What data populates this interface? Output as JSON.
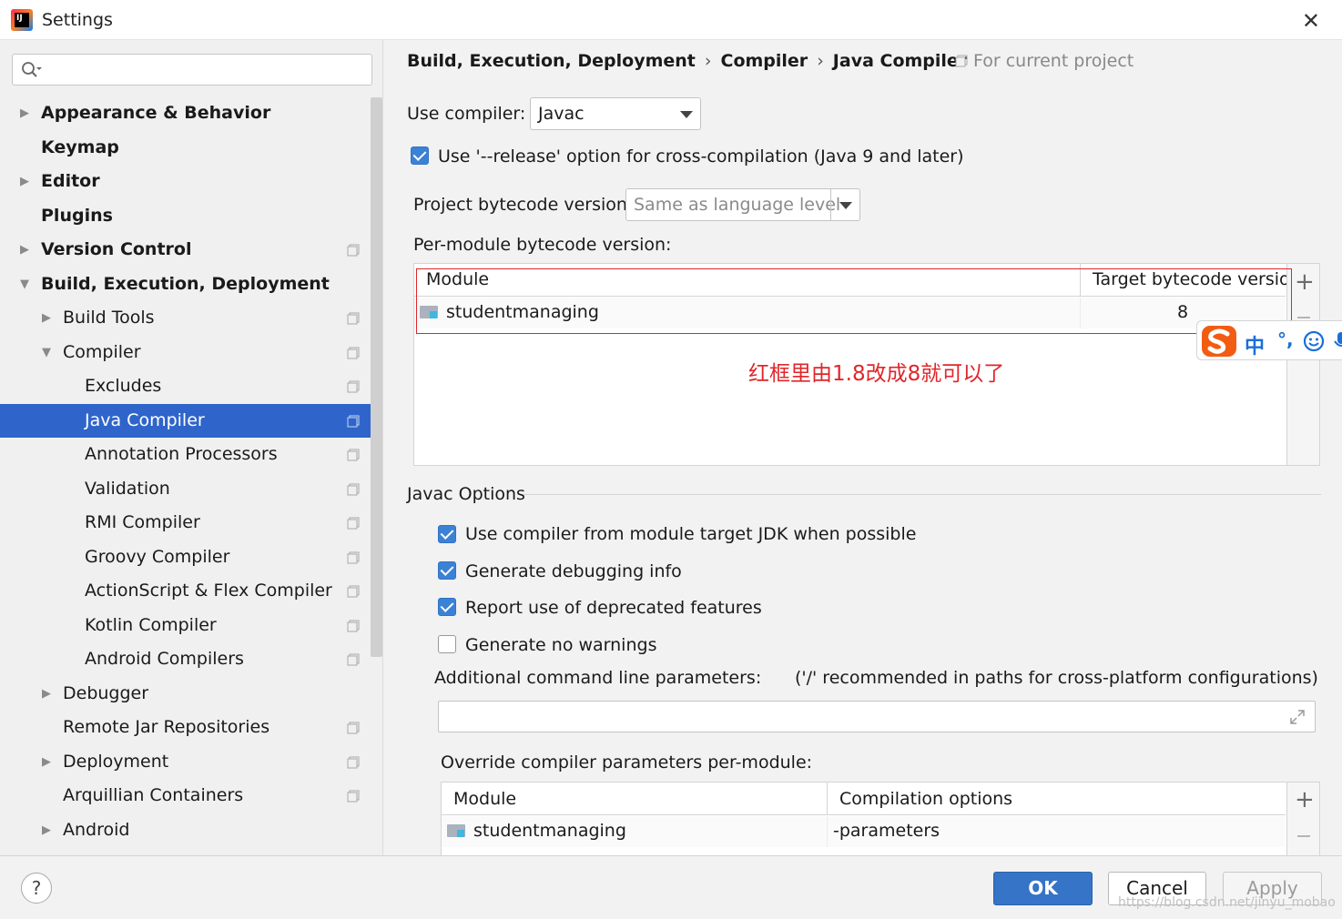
{
  "window": {
    "title": "Settings"
  },
  "search": {
    "placeholder": ""
  },
  "sidebar": {
    "items": [
      {
        "label": "Appearance & Behavior",
        "level": 0,
        "arrow": "right",
        "bold": true,
        "project": false
      },
      {
        "label": "Keymap",
        "level": 0,
        "arrow": "none",
        "bold": true,
        "project": false
      },
      {
        "label": "Editor",
        "level": 0,
        "arrow": "right",
        "bold": true,
        "project": false
      },
      {
        "label": "Plugins",
        "level": 0,
        "arrow": "none",
        "bold": true,
        "project": false
      },
      {
        "label": "Version Control",
        "level": 0,
        "arrow": "right",
        "bold": true,
        "project": true
      },
      {
        "label": "Build, Execution, Deployment",
        "level": 0,
        "arrow": "down",
        "bold": true,
        "project": false
      },
      {
        "label": "Build Tools",
        "level": 1,
        "arrow": "right",
        "bold": false,
        "project": true
      },
      {
        "label": "Compiler",
        "level": 1,
        "arrow": "down",
        "bold": false,
        "project": true
      },
      {
        "label": "Excludes",
        "level": 2,
        "arrow": "none",
        "bold": false,
        "project": true
      },
      {
        "label": "Java Compiler",
        "level": 2,
        "arrow": "none",
        "bold": false,
        "project": true,
        "selected": true
      },
      {
        "label": "Annotation Processors",
        "level": 2,
        "arrow": "none",
        "bold": false,
        "project": true
      },
      {
        "label": "Validation",
        "level": 2,
        "arrow": "none",
        "bold": false,
        "project": true
      },
      {
        "label": "RMI Compiler",
        "level": 2,
        "arrow": "none",
        "bold": false,
        "project": true
      },
      {
        "label": "Groovy Compiler",
        "level": 2,
        "arrow": "none",
        "bold": false,
        "project": true
      },
      {
        "label": "ActionScript & Flex Compiler",
        "level": 2,
        "arrow": "none",
        "bold": false,
        "project": true
      },
      {
        "label": "Kotlin Compiler",
        "level": 2,
        "arrow": "none",
        "bold": false,
        "project": true
      },
      {
        "label": "Android Compilers",
        "level": 2,
        "arrow": "none",
        "bold": false,
        "project": true
      },
      {
        "label": "Debugger",
        "level": 1,
        "arrow": "right",
        "bold": false,
        "project": false
      },
      {
        "label": "Remote Jar Repositories",
        "level": 1,
        "arrow": "none",
        "bold": false,
        "project": true
      },
      {
        "label": "Deployment",
        "level": 1,
        "arrow": "right",
        "bold": false,
        "project": true
      },
      {
        "label": "Arquillian Containers",
        "level": 1,
        "arrow": "none",
        "bold": false,
        "project": true
      },
      {
        "label": "Android",
        "level": 1,
        "arrow": "right",
        "bold": false,
        "project": false
      }
    ]
  },
  "breadcrumb": {
    "part1": "Build, Execution, Deployment",
    "part2": "Compiler",
    "part3": "Java Compiler",
    "separator": "›"
  },
  "scope": {
    "label": "For current project"
  },
  "compiler": {
    "use_label": "Use compiler:",
    "use_value": "Javac",
    "release_label": "Use '--release' option for cross-compilation (Java 9 and later)",
    "release_checked": true,
    "bytecode_label": "Project bytecode version:",
    "bytecode_value": "Same as language level",
    "per_module_label": "Per-module bytecode version:"
  },
  "bytecode_table": {
    "col_module": "Module",
    "col_target": "Target bytecode version",
    "rows": [
      {
        "module": "studentmanaging",
        "target": "8"
      }
    ]
  },
  "annotation": {
    "text": "红框里由1.8改成8就可以了"
  },
  "ime": {
    "zh": "中",
    "punct": "°,"
  },
  "javac": {
    "section_title": "Javac Options",
    "opt1_label": "Use compiler from module target JDK when possible",
    "opt1_checked": true,
    "opt2_label": "Generate debugging info",
    "opt2_checked": true,
    "opt3_label": "Report use of deprecated features",
    "opt3_checked": true,
    "opt4_label": "Generate no warnings",
    "opt4_checked": false,
    "params_label": "Additional command line parameters:",
    "params_hint": "('/' recommended in paths for cross-platform configurations)",
    "params_value": "",
    "override_label": "Override compiler parameters per-module:"
  },
  "override_table": {
    "col_module": "Module",
    "col_options": "Compilation options",
    "rows": [
      {
        "module": "studentmanaging",
        "options": "-parameters"
      }
    ]
  },
  "footer": {
    "help": "?",
    "ok": "OK",
    "cancel": "Cancel",
    "apply": "Apply"
  },
  "watermark": {
    "text": "https://blog.csdn.net/jinyu_mobao"
  },
  "colors": {
    "selection": "#2f65ca",
    "accent": "#3574c6",
    "annotation": "#e0262a"
  }
}
